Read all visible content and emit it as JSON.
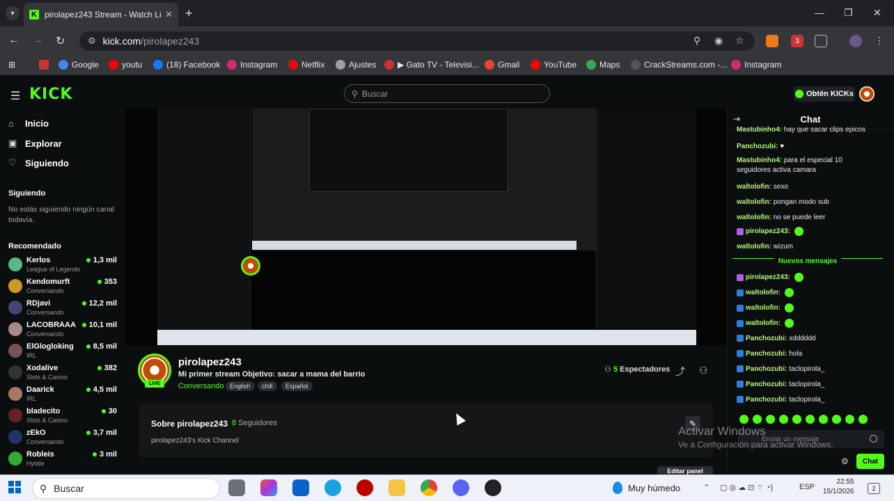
{
  "browser": {
    "tab_title": "pirolapez243 Stream - Watch Li",
    "url_host": "kick.com",
    "url_path": "/pirolapez243",
    "bookmarks": [
      {
        "label": "Google",
        "color": "#4285f4"
      },
      {
        "label": "youtu",
        "color": "#ff0000"
      },
      {
        "label": "(18) Facebook",
        "color": "#1877f2"
      },
      {
        "label": "Instagram",
        "color": "#d62976"
      },
      {
        "label": "Netflix",
        "color": "#e50914"
      },
      {
        "label": "Ajustes",
        "color": "#9aa0a6"
      },
      {
        "label": "▶ Gato TV - Televisi...",
        "color": "#c33"
      },
      {
        "label": "Gmail",
        "color": "#ea4335"
      },
      {
        "label": "YouTube",
        "color": "#ff0000"
      },
      {
        "label": "Maps",
        "color": "#34a853"
      },
      {
        "label": "CrackStreams.com -...",
        "color": "#555"
      },
      {
        "label": "Instagram",
        "color": "#d62976"
      }
    ]
  },
  "kick": {
    "logo": "KICK",
    "search_placeholder": "Buscar",
    "get_kicks": "Obtén KICKs",
    "nav": {
      "home": "Inicio",
      "explore": "Explorar",
      "following": "Siguiendo"
    },
    "following_header": "Siguiendo",
    "following_empty": "No estás siguiendo ningún canal todavía.",
    "recommended_header": "Recomendado",
    "recommended": [
      {
        "name": "Kerlos",
        "category": "League of Legends",
        "viewers": "1,3 mil",
        "color": "#5b8"
      },
      {
        "name": "Kendomurft",
        "category": "Conversando",
        "viewers": "353",
        "color": "#c92"
      },
      {
        "name": "RDjavi",
        "category": "Conversando",
        "viewers": "12,2 mil",
        "color": "#447"
      },
      {
        "name": "LACOBRAAA",
        "category": "Conversando",
        "viewers": "10,1 mil",
        "color": "#a88"
      },
      {
        "name": "ElGlogloking",
        "category": "IRL",
        "viewers": "8,5 mil",
        "color": "#755"
      },
      {
        "name": "Xodalive",
        "category": "Slots & Casino",
        "viewers": "382",
        "color": "#333"
      },
      {
        "name": "Daarick",
        "category": "IRL",
        "viewers": "4,5 mil",
        "color": "#a76"
      },
      {
        "name": "bladecito",
        "category": "Slots & Casino",
        "viewers": "30",
        "color": "#622"
      },
      {
        "name": "zEkO",
        "category": "Conversando",
        "viewers": "3,7 mil",
        "color": "#236"
      },
      {
        "name": "Robleis",
        "category": "Hytale",
        "viewers": "3 mil",
        "color": "#3a3"
      }
    ],
    "channel": {
      "name": "pirolapez243",
      "live_label": "LIVE",
      "title": "Mi primer stream Objetivo: sacar a mama del barrio",
      "category": "Conversando",
      "tags": [
        "English",
        "chill",
        "Español"
      ],
      "viewers_count": "5",
      "viewers_label": "Espectadores"
    },
    "about": {
      "title": "Sobre pirolapez243",
      "followers_count": "8",
      "followers_label": "Seguidores",
      "description": "pirolapez243's Kick Channel",
      "edit_panel": "Editar panel"
    },
    "chat": {
      "title": "Chat",
      "messages_before": [
        {
          "user": "Mastubinho4:",
          "text": "hay que sacar clips epicos",
          "badge": "none",
          "emote": false
        },
        {
          "user": "Panchozubi:",
          "text": "♥",
          "badge": "none",
          "emote": false
        },
        {
          "user": "Mastubinho4:",
          "text": "para el especial 10 seguidores activa camara",
          "badge": "none",
          "emote": false
        },
        {
          "user": "waltolofin:",
          "text": "sexo",
          "badge": "none",
          "emote": false
        },
        {
          "user": "waltolofin:",
          "text": "pongan modo sub",
          "badge": "none",
          "emote": false
        },
        {
          "user": "waltolofin:",
          "text": "no se puede leer",
          "badge": "none",
          "emote": false
        },
        {
          "user": "pirolapez243:",
          "text": "",
          "badge": "mic",
          "emote": true
        },
        {
          "user": "waltolofin:",
          "text": "wizum",
          "badge": "none",
          "emote": false
        }
      ],
      "new_messages_label": "Nuevos mensajes",
      "messages_after": [
        {
          "user": "pirolapez243:",
          "text": "",
          "badge": "mic",
          "emote": true
        },
        {
          "user": "waltolofin:",
          "text": "",
          "badge": "x",
          "emote": true
        },
        {
          "user": "waltolofin:",
          "text": "",
          "badge": "x",
          "emote": true
        },
        {
          "user": "waltolofin:",
          "text": "",
          "badge": "x",
          "emote": true
        },
        {
          "user": "Panchozubi:",
          "text": "xdddddd",
          "badge": "x",
          "emote": false
        },
        {
          "user": "Panchozubi:",
          "text": "hola",
          "badge": "x",
          "emote": false
        },
        {
          "user": "Panchozubi:",
          "text": "taclopirola_",
          "badge": "x",
          "emote": false
        },
        {
          "user": "Panchozubi:",
          "text": "taclopirola_",
          "badge": "x",
          "emote": false
        },
        {
          "user": "Panchozubi:",
          "text": "taclopirola_",
          "badge": "x",
          "emote": false
        }
      ],
      "input_placeholder": "Enviar un mensaje",
      "send_label": "Chat"
    },
    "watermark": {
      "line1": "Activar Windows",
      "line2": "Ve a Configuración para activar Windows."
    }
  },
  "taskbar": {
    "search": "Buscar",
    "weather": "Muy húmedo",
    "lang": "ESP",
    "time": "22:55",
    "date": "15/1/2026",
    "notifications": "2"
  },
  "colors": {
    "accent": "#53fc18",
    "background": "#0b0e0f"
  }
}
